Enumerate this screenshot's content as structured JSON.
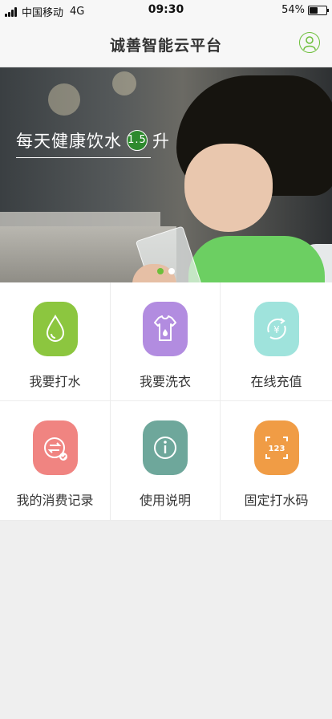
{
  "status": {
    "carrier": "中国移动",
    "network": "4G",
    "time": "09:30",
    "battery": "54%",
    "battery_level": 0.54
  },
  "nav": {
    "title": "诚善智能云平台",
    "profile_icon": "user-icon"
  },
  "banner": {
    "text": "每天健康饮水",
    "badge": "1.5",
    "unit": "升",
    "slides": 2,
    "active_slide": 1
  },
  "menu": [
    {
      "label": "我要打水",
      "icon": "water-drop-icon",
      "color": "#8cc63f"
    },
    {
      "label": "我要洗衣",
      "icon": "tshirt-icon",
      "color": "#b28ce0"
    },
    {
      "label": "在线充值",
      "icon": "yuan-recharge-icon",
      "color": "#9fe3dc"
    },
    {
      "label": "我的消费记录",
      "icon": "exchange-icon",
      "color": "#f08481"
    },
    {
      "label": "使用说明",
      "icon": "info-icon",
      "color": "#6ea79b"
    },
    {
      "label": "固定打水码",
      "icon": "scan-code-icon",
      "color": "#f09c45"
    }
  ],
  "colors": {
    "accent": "#6cbf3a",
    "background": "#efefef"
  }
}
